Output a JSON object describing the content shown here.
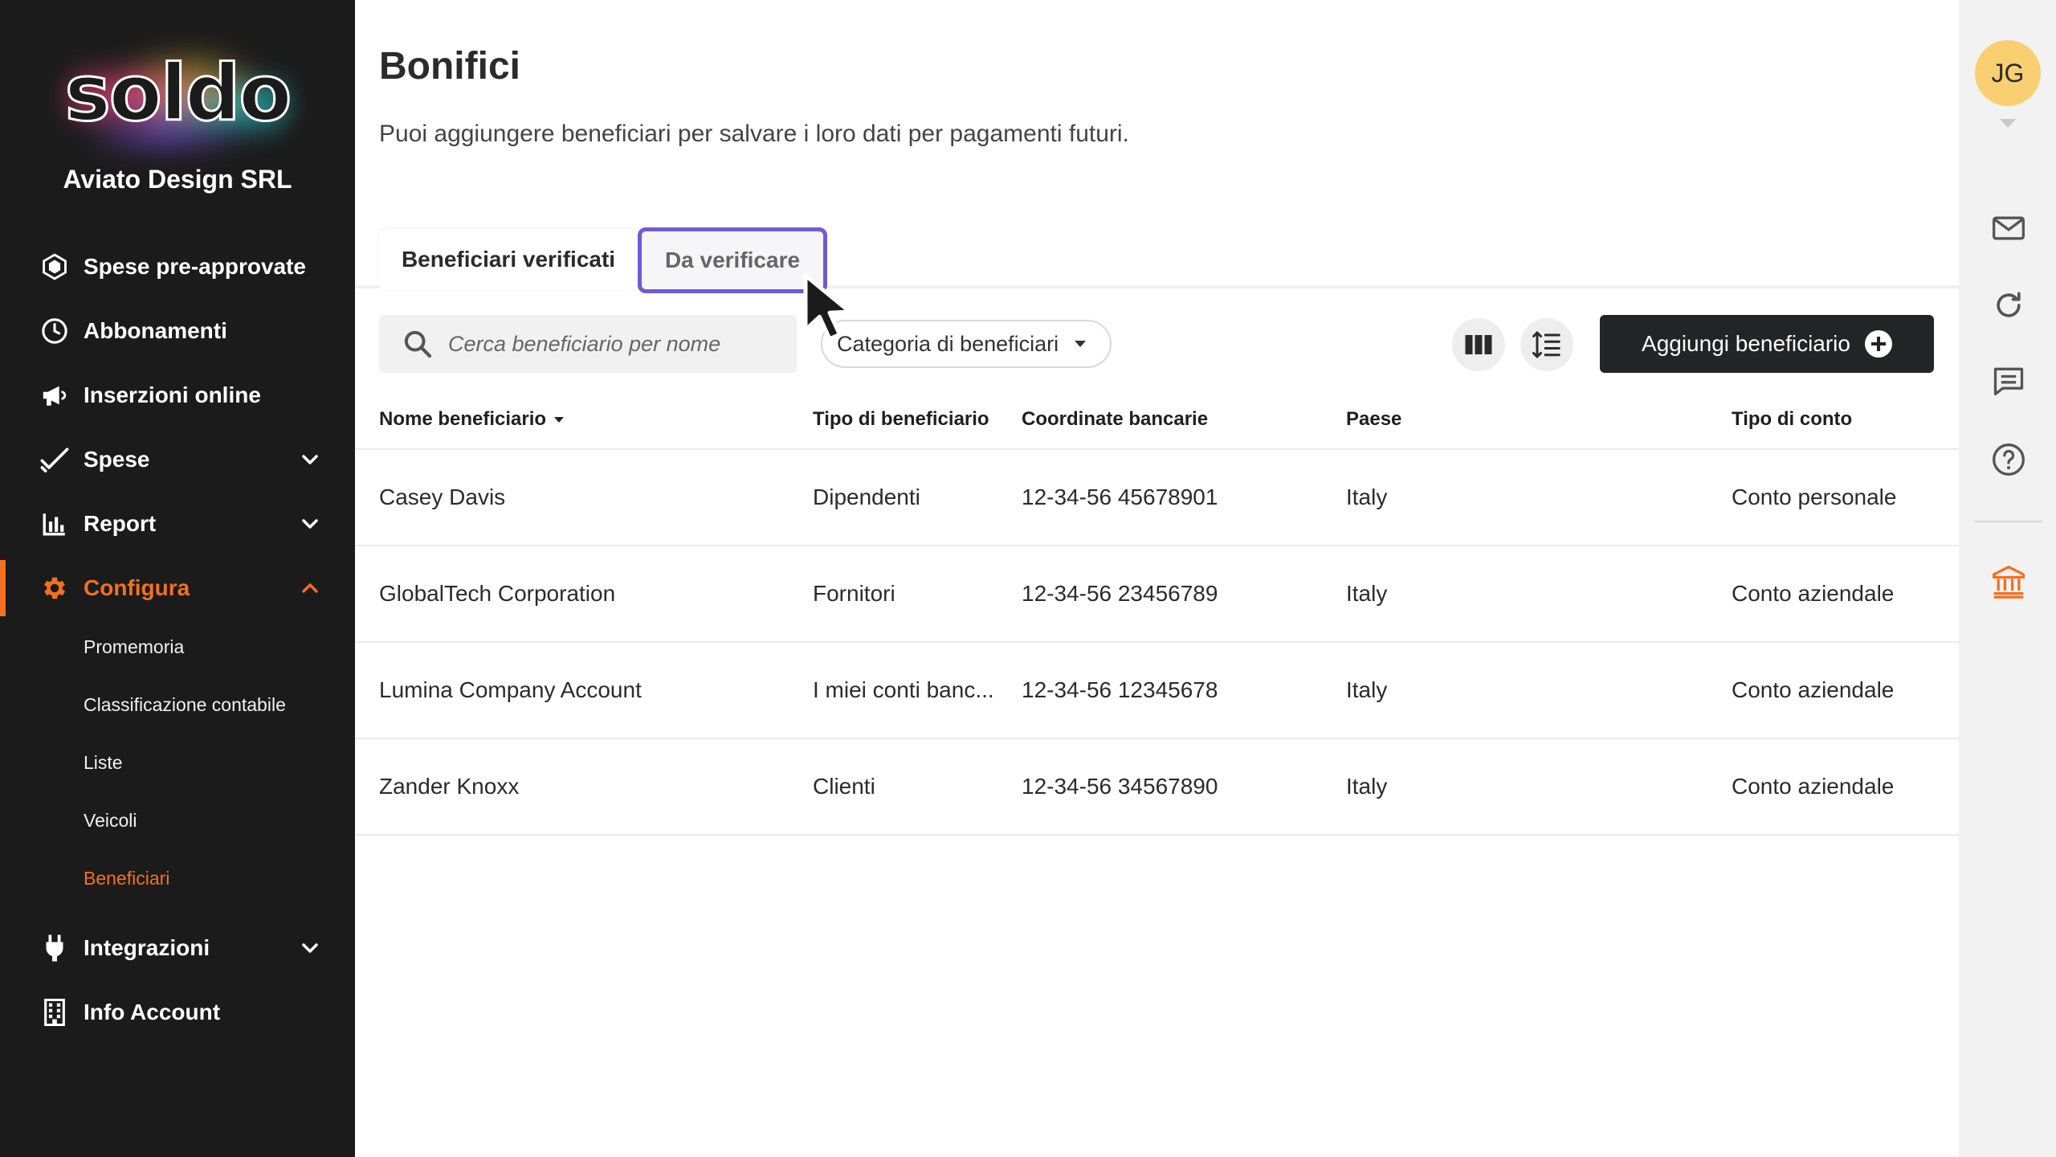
{
  "brand": {
    "logo_text": "soldo",
    "company": "Aviato Design SRL",
    "accent": "#f37021"
  },
  "sidebar": {
    "items": [
      {
        "label": "Spese pre-approvate",
        "icon": "hexagon-icon"
      },
      {
        "label": "Abbonamenti",
        "icon": "clock-icon"
      },
      {
        "label": "Inserzioni online",
        "icon": "megaphone-icon"
      },
      {
        "label": "Spese",
        "icon": "check-icon",
        "expandable": true
      },
      {
        "label": "Report",
        "icon": "bar-chart-icon",
        "expandable": true
      },
      {
        "label": "Configura",
        "icon": "gear-icon",
        "expandable": true,
        "active": true
      },
      {
        "label": "Integrazioni",
        "icon": "plug-icon",
        "expandable": true
      },
      {
        "label": "Info Account",
        "icon": "building-icon"
      }
    ],
    "subitems": [
      "Promemoria",
      "Classificazione contabile",
      "Liste",
      "Veicoli",
      "Beneficiari"
    ],
    "active_subitem": "Beneficiari"
  },
  "main": {
    "title": "Bonifici",
    "subtitle": "Puoi aggiungere beneficiari per salvare i loro dati per pagamenti futuri.",
    "tabs": [
      {
        "label": "Beneficiari verificati",
        "selected": true
      },
      {
        "label": "Da verificare",
        "selected": false,
        "focused": true
      }
    ],
    "search": {
      "placeholder": "Cerca beneficiario per nome",
      "value": ""
    },
    "filter_label": "Categoria di beneficiari",
    "add_button": "Aggiungi beneficiario",
    "table": {
      "columns": [
        "Nome beneficiario",
        "Tipo di beneficiario",
        "Coordinate bancarie",
        "Paese",
        "Tipo di conto"
      ],
      "rows": [
        [
          "Casey Davis",
          "Dipendenti",
          "12-34-56 45678901",
          "Italy",
          "Conto personale"
        ],
        [
          "GlobalTech Corporation",
          "Fornitori",
          "12-34-56 23456789",
          "Italy",
          "Conto aziendale"
        ],
        [
          "Lumina Company Account",
          "I miei conti banc...",
          "12-34-56 12345678",
          "Italy",
          "Conto aziendale"
        ],
        [
          "Zander Knoxx",
          "Clienti",
          "12-34-56 34567890",
          "Italy",
          "Conto aziendale"
        ]
      ]
    }
  },
  "rail": {
    "avatar_initials": "JG",
    "avatar_color": "#f9cf71",
    "icons": [
      "mail-icon",
      "refresh-icon",
      "chat-icon",
      "help-icon",
      "bank-icon"
    ]
  }
}
